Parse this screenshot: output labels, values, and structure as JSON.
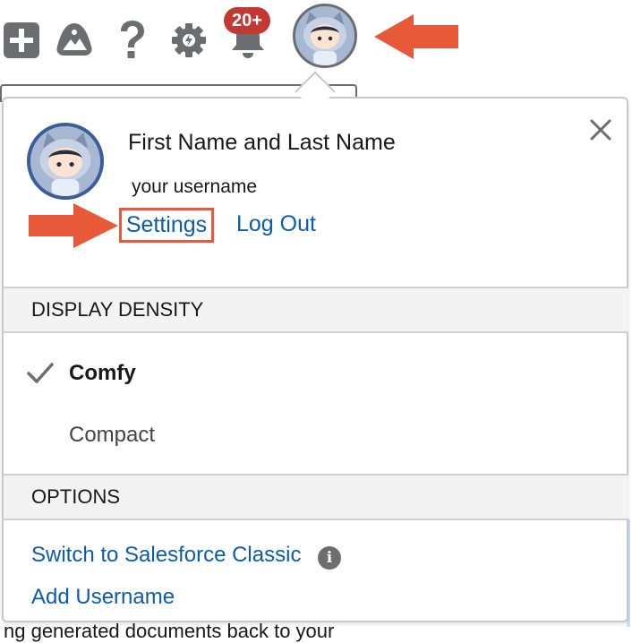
{
  "toolbar": {
    "notification_count": "20+",
    "icons": [
      "add-icon",
      "trailhead-icon",
      "help-icon",
      "setup-gear-icon",
      "notifications-bell-icon",
      "avatar"
    ]
  },
  "user": {
    "full_name": "First Name and Last Name",
    "username": "your username",
    "settings_label": "Settings",
    "logout_label": "Log Out"
  },
  "density": {
    "heading": "DISPLAY DENSITY",
    "options": [
      {
        "label": "Comfy",
        "selected": true
      },
      {
        "label": "Compact",
        "selected": false
      }
    ]
  },
  "options": {
    "heading": "OPTIONS",
    "switch_classic": "Switch to Salesforce Classic",
    "add_username": "Add Username"
  },
  "background": {
    "partial_text": "ng generated documents back to your"
  },
  "colors": {
    "link": "#0b5cab",
    "highlight_arrow": "#e8593a",
    "badge": "#c23934",
    "icon_gray": "#6b6d70"
  }
}
